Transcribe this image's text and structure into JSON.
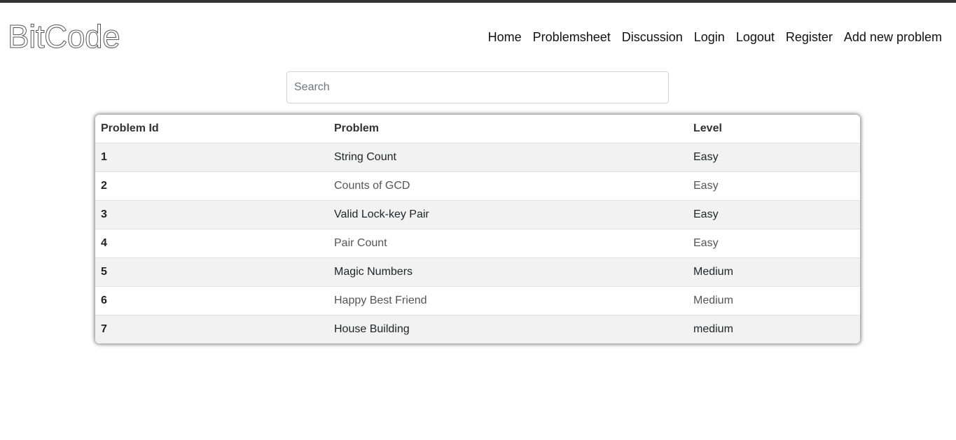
{
  "header": {
    "brand": "BitCode",
    "nav": [
      "Home",
      "Problemsheet",
      "Discussion",
      "Login",
      "Logout",
      "Register",
      "Add new problem"
    ]
  },
  "search": {
    "placeholder": "Search",
    "value": ""
  },
  "table": {
    "columns": [
      "Problem Id",
      "Problem",
      "Level"
    ],
    "rows": [
      {
        "id": "1",
        "problem": "String Count",
        "level": "Easy"
      },
      {
        "id": "2",
        "problem": "Counts of GCD",
        "level": "Easy"
      },
      {
        "id": "3",
        "problem": "Valid Lock-key Pair",
        "level": "Easy"
      },
      {
        "id": "4",
        "problem": "Pair Count",
        "level": "Easy"
      },
      {
        "id": "5",
        "problem": "Magic Numbers",
        "level": "Medium"
      },
      {
        "id": "6",
        "problem": "Happy Best Friend",
        "level": "Medium"
      },
      {
        "id": "7",
        "problem": "House Building",
        "level": "medium"
      }
    ]
  },
  "colors": {
    "top_strip": "#333333",
    "stripe": "#f2f2f2",
    "text": "#212529"
  }
}
